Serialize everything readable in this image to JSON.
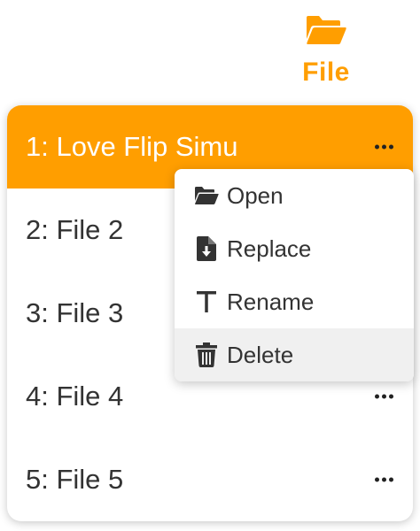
{
  "file_button": {
    "label": "File",
    "icon": "folder-open-icon",
    "color": "#FF9E00"
  },
  "files": [
    {
      "label": "1: Love Flip Simu",
      "active": true
    },
    {
      "label": "2: File 2"
    },
    {
      "label": "3: File 3"
    },
    {
      "label": "4: File 4"
    },
    {
      "label": "5: File 5"
    }
  ],
  "context_menu": {
    "items": [
      {
        "label": "Open",
        "icon": "folder-open-icon"
      },
      {
        "label": "Replace",
        "icon": "file-import-icon"
      },
      {
        "label": "Rename",
        "icon": "text-icon"
      },
      {
        "label": "Delete",
        "icon": "trash-icon",
        "hovered": true
      }
    ]
  },
  "colors": {
    "accent": "#FF9E00",
    "text": "#333333",
    "hover": "#f0f0f0"
  }
}
